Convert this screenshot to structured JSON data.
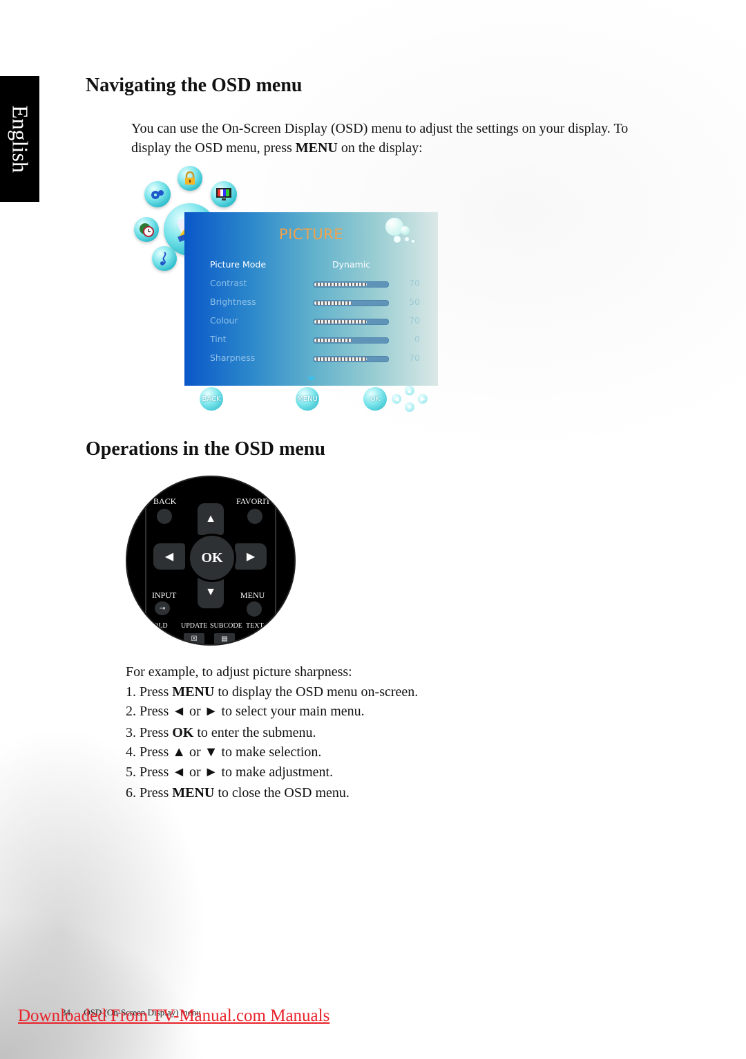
{
  "language_tab": "English",
  "section1": {
    "heading": "Navigating the OSD menu",
    "intro_part1": "You can use the On-Screen Display (OSD) menu to adjust the settings on your display. To display the OSD menu, press ",
    "intro_keyword": "MENU",
    "intro_part2": " on the display:"
  },
  "osd_screen": {
    "menu_icons": [
      "settings-gear-icon",
      "lock-icon",
      "tv-color-bars-icon",
      "picture-icon",
      "globe-clock-icon",
      "music-note-icon"
    ],
    "title": "PICTURE",
    "accent_color": "#f3a24a",
    "mode_row": {
      "label": "Picture Mode",
      "value": "Dynamic"
    },
    "rows": [
      {
        "label": "Contrast",
        "value": 70,
        "fill_percent": 70
      },
      {
        "label": "Brightness",
        "value": 50,
        "fill_percent": 50
      },
      {
        "label": "Colour",
        "value": 70,
        "fill_percent": 70
      },
      {
        "label": "Tint",
        "value": 0,
        "fill_percent": 50
      },
      {
        "label": "Sharpness",
        "value": 70,
        "fill_percent": 70
      }
    ],
    "buttons": {
      "back": "BACK",
      "menu": "MENU",
      "ok": "OK"
    }
  },
  "section2": {
    "heading": "Operations in the OSD menu"
  },
  "remote": {
    "back": "BACK",
    "favorite": "FAVORIT",
    "ok": "OK",
    "input": "INPUT",
    "menu": "MENU",
    "hold": "OLD",
    "update": "UPDATE",
    "subcode": "SUBCODE",
    "text": "TEXT"
  },
  "steps": {
    "intro": "For example, to adjust picture sharpness:",
    "items": [
      {
        "prefix": "1. Press ",
        "key": "MENU",
        "suffix": " to display the OSD menu on-screen."
      },
      {
        "prefix": "2. Press ◄ or ► to select your main menu.",
        "key": "",
        "suffix": ""
      },
      {
        "prefix": "3. Press ",
        "key": "OK",
        "suffix": " to enter the submenu."
      },
      {
        "prefix": "4. Press ▲ or ▼ to make selection.",
        "key": "",
        "suffix": ""
      },
      {
        "prefix": "5. Press ◄ or ► to make adjustment.",
        "key": "",
        "suffix": ""
      },
      {
        "prefix": "6. Press ",
        "key": "MENU",
        "suffix": " to close the OSD menu."
      }
    ]
  },
  "footer": {
    "page_number": "34",
    "chapter": "OSD (On-Screen Display) menu",
    "download_link": "Downloaded From TV-Manual.com Manuals",
    "link_color": "#e8222a"
  }
}
